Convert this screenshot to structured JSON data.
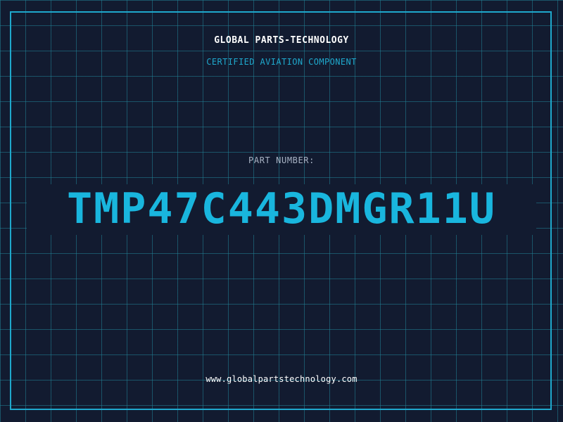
{
  "header": {
    "brand": "GLOBAL PARTS-TECHNOLOGY",
    "subtitle": "CERTIFIED AVIATION COMPONENT"
  },
  "part": {
    "label": "PART NUMBER:",
    "number": "TMP47C443DMGR11U"
  },
  "footer": {
    "website": "www.globalpartstechnology.com"
  },
  "colors": {
    "background": "#121b30",
    "grid": "#228296",
    "accent": "#1fa8cc",
    "part_number": "#19b6de",
    "label": "#a8b3c4",
    "text": "#ffffff"
  }
}
